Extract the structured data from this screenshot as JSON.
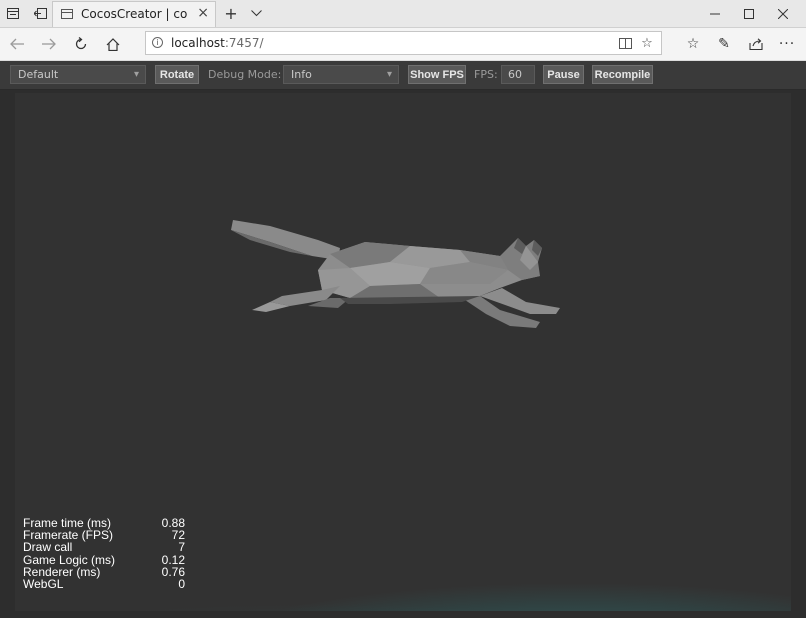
{
  "browser": {
    "tab_title": "CocosCreator | cocos-cr",
    "address_host": "localhost",
    "address_rest": ":7457/"
  },
  "toolbar": {
    "scene_select": "Default",
    "rotate_label": "Rotate",
    "debug_mode_label": "Debug Mode:",
    "debug_mode_value": "Info",
    "show_fps_label": "Show FPS",
    "fps_label": "FPS:",
    "fps_value": "60",
    "pause_label": "Pause",
    "recompile_label": "Recompile"
  },
  "stats": [
    {
      "label": "Frame time (ms)",
      "value": "0.88"
    },
    {
      "label": "Framerate (FPS)",
      "value": "72"
    },
    {
      "label": "Draw call",
      "value": "7"
    },
    {
      "label": "Game Logic (ms)",
      "value": "0.12"
    },
    {
      "label": "Renderer (ms)",
      "value": "0.76"
    },
    {
      "label": "WebGL",
      "value": "0"
    }
  ],
  "icons": {
    "tab_actions": "tabs-aside-icon",
    "tab_back": "tab-back-icon",
    "new_tab": "plus-icon",
    "tab_list": "chevron-down-icon",
    "minimize": "minimize-icon",
    "maximize": "maximize-icon",
    "close": "close-icon",
    "back": "arrow-left-icon",
    "forward": "arrow-right-icon",
    "refresh": "refresh-icon",
    "home": "home-icon",
    "reading_view": "book-icon",
    "favorite": "star-icon",
    "favorites_hub": "star-list-icon",
    "notes": "pen-icon",
    "share": "share-icon",
    "more": "more-icon"
  }
}
